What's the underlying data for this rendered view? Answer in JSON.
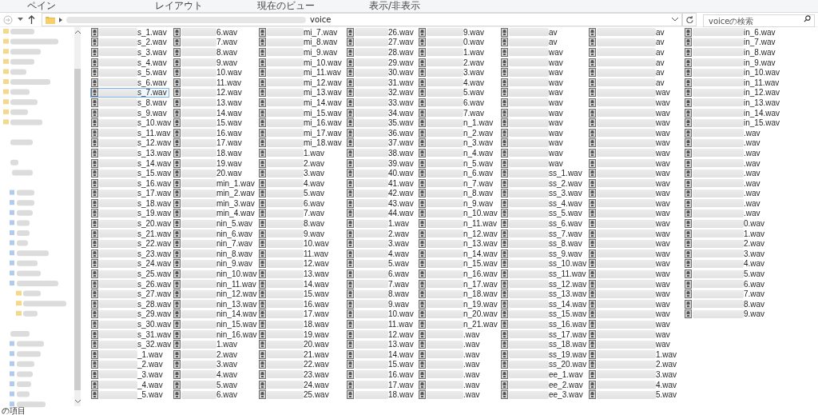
{
  "ribbon": {
    "groups": [
      "ペイン",
      "レイアウト",
      "現在のビュー",
      "表示/非表示"
    ]
  },
  "address_bar": {
    "current_folder": "voice"
  },
  "search": {
    "placeholder": "voiceの検索"
  },
  "columns": [
    {
      "files": [
        {
          "name": "s_1.wav",
          "selected": false
        },
        {
          "name": "s_2.wav",
          "selected": false
        },
        {
          "name": "s_3.wav",
          "selected": false
        },
        {
          "name": "s_4.wav",
          "selected": false
        },
        {
          "name": "s_5.wav",
          "selected": false
        },
        {
          "name": "s_6.wav",
          "selected": false
        },
        {
          "name": "s_7.wav",
          "selected": true
        },
        {
          "name": "s_8.wav",
          "selected": false
        },
        {
          "name": "s_9.wav",
          "selected": false
        },
        {
          "name": "s_10.wav",
          "selected": false
        },
        {
          "name": "s_11.wav",
          "selected": false
        },
        {
          "name": "s_12.wav",
          "selected": false
        },
        {
          "name": "s_13.wav",
          "selected": false
        },
        {
          "name": "s_14.wav",
          "selected": false
        },
        {
          "name": "s_15.wav",
          "selected": false
        },
        {
          "name": "s_16.wav",
          "selected": false
        },
        {
          "name": "s_17.wav",
          "selected": false
        },
        {
          "name": "s_18.wav",
          "selected": false
        },
        {
          "name": "s_19.wav",
          "selected": false
        },
        {
          "name": "s_20.wav",
          "selected": false
        },
        {
          "name": "s_21.wav",
          "selected": false
        },
        {
          "name": "s_22.wav",
          "selected": false
        },
        {
          "name": "s_23.wav",
          "selected": false
        },
        {
          "name": "s_24.wav",
          "selected": false
        },
        {
          "name": "s_25.wav",
          "selected": false
        },
        {
          "name": "s_26.wav",
          "selected": false
        },
        {
          "name": "s_27.wav",
          "selected": false
        },
        {
          "name": "s_28.wav",
          "selected": false
        },
        {
          "name": "s_29.wav",
          "selected": false
        },
        {
          "name": "s_30.wav",
          "selected": false
        },
        {
          "name": "s_31.wav",
          "selected": false
        },
        {
          "name": "s_32.wav",
          "selected": false
        },
        {
          "name": "_1.wav",
          "selected": false
        },
        {
          "name": "_2.wav",
          "selected": false
        },
        {
          "name": "_3.wav",
          "selected": false
        },
        {
          "name": "_4.wav",
          "selected": false
        },
        {
          "name": "_5.wav",
          "selected": false
        }
      ]
    },
    {
      "files": [
        {
          "name": "6.wav",
          "selected": false
        },
        {
          "name": "7.wav",
          "selected": false
        },
        {
          "name": "8.wav",
          "selected": false
        },
        {
          "name": "9.wav",
          "selected": false
        },
        {
          "name": "10.wav",
          "selected": false
        },
        {
          "name": "11.wav",
          "selected": false
        },
        {
          "name": "12.wav",
          "selected": false
        },
        {
          "name": "13.wav",
          "selected": false
        },
        {
          "name": "14.wav",
          "selected": false
        },
        {
          "name": "15.wav",
          "selected": false
        },
        {
          "name": "16.wav",
          "selected": false
        },
        {
          "name": "17.wav",
          "selected": false
        },
        {
          "name": "18.wav",
          "selected": false
        },
        {
          "name": "19.wav",
          "selected": false
        },
        {
          "name": "20.wav",
          "selected": false
        },
        {
          "name": "min_1.wav",
          "selected": false
        },
        {
          "name": "min_2.wav",
          "selected": false
        },
        {
          "name": "min_3.wav",
          "selected": false
        },
        {
          "name": "min_4.wav",
          "selected": false
        },
        {
          "name": "nin_5.wav",
          "selected": false
        },
        {
          "name": "nin_6.wav",
          "selected": false
        },
        {
          "name": "nin_7.wav",
          "selected": false
        },
        {
          "name": "nin_8.wav",
          "selected": false
        },
        {
          "name": "nin_9.wav",
          "selected": false
        },
        {
          "name": "nin_10.wav",
          "selected": false
        },
        {
          "name": "nin_11.wav",
          "selected": false
        },
        {
          "name": "nin_12.wav",
          "selected": false
        },
        {
          "name": "nin_13.wav",
          "selected": false
        },
        {
          "name": "nin_14.wav",
          "selected": false
        },
        {
          "name": "nin_15.wav",
          "selected": false
        },
        {
          "name": "nin_16.wav",
          "selected": false
        },
        {
          "name": "1.wav",
          "selected": false
        },
        {
          "name": "2.wav",
          "selected": false
        },
        {
          "name": "3.wav",
          "selected": false
        },
        {
          "name": "4.wav",
          "selected": false
        },
        {
          "name": "5.wav",
          "selected": false
        },
        {
          "name": "6.wav",
          "selected": false
        }
      ]
    },
    {
      "files": [
        {
          "name": "mi_7.wav",
          "selected": false
        },
        {
          "name": "mi_8.wav",
          "selected": false
        },
        {
          "name": "mi_9.wav",
          "selected": false
        },
        {
          "name": "mi_10.wav",
          "selected": false
        },
        {
          "name": "mi_11.wav",
          "selected": false
        },
        {
          "name": "mi_12.wav",
          "selected": false
        },
        {
          "name": "mi_13.wav",
          "selected": false
        },
        {
          "name": "mi_14.wav",
          "selected": false
        },
        {
          "name": "mi_15.wav",
          "selected": false
        },
        {
          "name": "mi_16.wav",
          "selected": false
        },
        {
          "name": "mi_17.wav",
          "selected": false
        },
        {
          "name": "mi_18.wav",
          "selected": false
        },
        {
          "name": "1.wav",
          "selected": false
        },
        {
          "name": "2.wav",
          "selected": false
        },
        {
          "name": "3.wav",
          "selected": false
        },
        {
          "name": "4.wav",
          "selected": false
        },
        {
          "name": "5.wav",
          "selected": false
        },
        {
          "name": "6.wav",
          "selected": false
        },
        {
          "name": "7.wav",
          "selected": false
        },
        {
          "name": "8.wav",
          "selected": false
        },
        {
          "name": "9.wav",
          "selected": false
        },
        {
          "name": "10.wav",
          "selected": false
        },
        {
          "name": "11.wav",
          "selected": false
        },
        {
          "name": "12.wav",
          "selected": false
        },
        {
          "name": "13.wav",
          "selected": false
        },
        {
          "name": "14.wav",
          "selected": false
        },
        {
          "name": "15.wav",
          "selected": false
        },
        {
          "name": "16.wav",
          "selected": false
        },
        {
          "name": "17.wav",
          "selected": false
        },
        {
          "name": "18.wav",
          "selected": false
        },
        {
          "name": "19.wav",
          "selected": false
        },
        {
          "name": "20.wav",
          "selected": false
        },
        {
          "name": "21.wav",
          "selected": false
        },
        {
          "name": "22.wav",
          "selected": false
        },
        {
          "name": "23.wav",
          "selected": false
        },
        {
          "name": "24.wav",
          "selected": false
        },
        {
          "name": "25.wav",
          "selected": false
        }
      ]
    },
    {
      "files": [
        {
          "name": "26.wav",
          "selected": false
        },
        {
          "name": "27.wav",
          "selected": false
        },
        {
          "name": "28.wav",
          "selected": false
        },
        {
          "name": "29.wav",
          "selected": false
        },
        {
          "name": "30.wav",
          "selected": false
        },
        {
          "name": "31.wav",
          "selected": false
        },
        {
          "name": "32.wav",
          "selected": false
        },
        {
          "name": "33.wav",
          "selected": false
        },
        {
          "name": "34.wav",
          "selected": false
        },
        {
          "name": "35.wav",
          "selected": false
        },
        {
          "name": "36.wav",
          "selected": false
        },
        {
          "name": "37.wav",
          "selected": false
        },
        {
          "name": "38.wav",
          "selected": false
        },
        {
          "name": "39.wav",
          "selected": false
        },
        {
          "name": "40.wav",
          "selected": false
        },
        {
          "name": "41.wav",
          "selected": false
        },
        {
          "name": "42.wav",
          "selected": false
        },
        {
          "name": "43.wav",
          "selected": false
        },
        {
          "name": "44.wav",
          "selected": false
        },
        {
          "name": "1.wav",
          "selected": false
        },
        {
          "name": "2.wav",
          "selected": false
        },
        {
          "name": "3.wav",
          "selected": false
        },
        {
          "name": "4.wav",
          "selected": false
        },
        {
          "name": "5.wav",
          "selected": false
        },
        {
          "name": "6.wav",
          "selected": false
        },
        {
          "name": "7.wav",
          "selected": false
        },
        {
          "name": "8.wav",
          "selected": false
        },
        {
          "name": "9.wav",
          "selected": false
        },
        {
          "name": "10.wav",
          "selected": false
        },
        {
          "name": "11.wav",
          "selected": false
        },
        {
          "name": "12.wav",
          "selected": false
        },
        {
          "name": "13.wav",
          "selected": false
        },
        {
          "name": "14.wav",
          "selected": false
        },
        {
          "name": "15.wav",
          "selected": false
        },
        {
          "name": "16.wav",
          "selected": false
        },
        {
          "name": "17.wav",
          "selected": false
        },
        {
          "name": "18.wav",
          "selected": false
        }
      ]
    },
    {
      "files": [
        {
          "name": "9.wav",
          "selected": false
        },
        {
          "name": "0.wav",
          "selected": false
        },
        {
          "name": "1.wav",
          "selected": false
        },
        {
          "name": "2.wav",
          "selected": false
        },
        {
          "name": "3.wav",
          "selected": false
        },
        {
          "name": "4.wav",
          "selected": false
        },
        {
          "name": "5.wav",
          "selected": false
        },
        {
          "name": "6.wav",
          "selected": false
        },
        {
          "name": "7.wav",
          "selected": false
        },
        {
          "name": "n_1.wav",
          "selected": false
        },
        {
          "name": "n_2.wav",
          "selected": false
        },
        {
          "name": "n_3.wav",
          "selected": false
        },
        {
          "name": "n_4.wav",
          "selected": false
        },
        {
          "name": "n_5.wav",
          "selected": false
        },
        {
          "name": "n_6.wav",
          "selected": false
        },
        {
          "name": "n_7.wav",
          "selected": false
        },
        {
          "name": "n_8.wav",
          "selected": false
        },
        {
          "name": "n_9.wav",
          "selected": false
        },
        {
          "name": "n_10.wav",
          "selected": false
        },
        {
          "name": "n_11.wav",
          "selected": false
        },
        {
          "name": "n_12.wav",
          "selected": false
        },
        {
          "name": "n_13.wav",
          "selected": false
        },
        {
          "name": "n_14.wav",
          "selected": false
        },
        {
          "name": "n_15.wav",
          "selected": false
        },
        {
          "name": "n_16.wav",
          "selected": false
        },
        {
          "name": "n_17.wav",
          "selected": false
        },
        {
          "name": "n_18.wav",
          "selected": false
        },
        {
          "name": "n_19.wav",
          "selected": false
        },
        {
          "name": "n_20.wav",
          "selected": false
        },
        {
          "name": "n_21.wav",
          "selected": false
        },
        {
          "name": ".wav",
          "selected": false
        },
        {
          "name": ".wav",
          "selected": false
        },
        {
          "name": ".wav",
          "selected": false
        },
        {
          "name": ".wav",
          "selected": false
        },
        {
          "name": ".wav",
          "selected": false
        },
        {
          "name": ".wav",
          "selected": false
        },
        {
          "name": ".wav",
          "selected": false
        }
      ]
    },
    {
      "files": [
        {
          "name": "av",
          "selected": false
        },
        {
          "name": "av",
          "selected": false
        },
        {
          "name": "wav",
          "selected": false
        },
        {
          "name": "wav",
          "selected": false
        },
        {
          "name": "wav",
          "selected": false
        },
        {
          "name": "wav",
          "selected": false
        },
        {
          "name": "wav",
          "selected": false
        },
        {
          "name": "wav",
          "selected": false
        },
        {
          "name": "wav",
          "selected": false
        },
        {
          "name": "wav",
          "selected": false
        },
        {
          "name": "wav",
          "selected": false
        },
        {
          "name": "wav",
          "selected": false
        },
        {
          "name": "wav",
          "selected": false
        },
        {
          "name": "wav",
          "selected": false
        },
        {
          "name": "ss_1.wav",
          "selected": false
        },
        {
          "name": "ss_2.wav",
          "selected": false
        },
        {
          "name": "ss_3.wav",
          "selected": false
        },
        {
          "name": "ss_4.wav",
          "selected": false
        },
        {
          "name": "ss_5.wav",
          "selected": false
        },
        {
          "name": "ss_6.wav",
          "selected": false
        },
        {
          "name": "ss_7.wav",
          "selected": false
        },
        {
          "name": "ss_8.wav",
          "selected": false
        },
        {
          "name": "ss_9.wav",
          "selected": false
        },
        {
          "name": "ss_10.wav",
          "selected": false
        },
        {
          "name": "ss_11.wav",
          "selected": false
        },
        {
          "name": "ss_12.wav",
          "selected": false
        },
        {
          "name": "ss_13.wav",
          "selected": false
        },
        {
          "name": "ss_14.wav",
          "selected": false
        },
        {
          "name": "ss_15.wav",
          "selected": false
        },
        {
          "name": "ss_16.wav",
          "selected": false
        },
        {
          "name": "ss_17.wav",
          "selected": false
        },
        {
          "name": "ss_18.wav",
          "selected": false
        },
        {
          "name": "ss_19.wav",
          "selected": false
        },
        {
          "name": "ss_20.wav",
          "selected": false
        },
        {
          "name": "ee_1.wav",
          "selected": false
        },
        {
          "name": "ee_2.wav",
          "selected": false
        },
        {
          "name": "ee_3.wav",
          "selected": false
        }
      ]
    },
    {
      "files": [
        {
          "name": "av",
          "selected": false
        },
        {
          "name": "av",
          "selected": false
        },
        {
          "name": "av",
          "selected": false
        },
        {
          "name": "av",
          "selected": false
        },
        {
          "name": "av",
          "selected": false
        },
        {
          "name": "av",
          "selected": false
        },
        {
          "name": "wav",
          "selected": false
        },
        {
          "name": "wav",
          "selected": false
        },
        {
          "name": "wav",
          "selected": false
        },
        {
          "name": "wav",
          "selected": false
        },
        {
          "name": "wav",
          "selected": false
        },
        {
          "name": "wav",
          "selected": false
        },
        {
          "name": "wav",
          "selected": false
        },
        {
          "name": "wav",
          "selected": false
        },
        {
          "name": "wav",
          "selected": false
        },
        {
          "name": "wav",
          "selected": false
        },
        {
          "name": "wav",
          "selected": false
        },
        {
          "name": "wav",
          "selected": false
        },
        {
          "name": "wav",
          "selected": false
        },
        {
          "name": "wav",
          "selected": false
        },
        {
          "name": "wav",
          "selected": false
        },
        {
          "name": "wav",
          "selected": false
        },
        {
          "name": "wav",
          "selected": false
        },
        {
          "name": "wav",
          "selected": false
        },
        {
          "name": "wav",
          "selected": false
        },
        {
          "name": "wav",
          "selected": false
        },
        {
          "name": "wav",
          "selected": false
        },
        {
          "name": "wav",
          "selected": false
        },
        {
          "name": "wav",
          "selected": false
        },
        {
          "name": "wav",
          "selected": false
        },
        {
          "name": "wav",
          "selected": false
        },
        {
          "name": "wav",
          "selected": false
        },
        {
          "name": "1.wav",
          "selected": false
        },
        {
          "name": "2.wav",
          "selected": false
        },
        {
          "name": "3.wav",
          "selected": false
        },
        {
          "name": "4.wav",
          "selected": false
        },
        {
          "name": "5.wav",
          "selected": false
        }
      ]
    },
    {
      "files": [
        {
          "name": "in_6.wav",
          "selected": false
        },
        {
          "name": "in_7.wav",
          "selected": false
        },
        {
          "name": "in_8.wav",
          "selected": false
        },
        {
          "name": "in_9.wav",
          "selected": false
        },
        {
          "name": "in_10.wav",
          "selected": false
        },
        {
          "name": "in_11.wav",
          "selected": false
        },
        {
          "name": "in_12.wav",
          "selected": false
        },
        {
          "name": "in_13.wav",
          "selected": false
        },
        {
          "name": "in_14.wav",
          "selected": false
        },
        {
          "name": "in_15.wav",
          "selected": false
        },
        {
          "name": ".wav",
          "selected": false
        },
        {
          "name": ".wav",
          "selected": false
        },
        {
          "name": ".wav",
          "selected": false
        },
        {
          "name": ".wav",
          "selected": false
        },
        {
          "name": ".wav",
          "selected": false
        },
        {
          "name": ".wav",
          "selected": false
        },
        {
          "name": ".wav",
          "selected": false
        },
        {
          "name": ".wav",
          "selected": false
        },
        {
          "name": ".wav",
          "selected": false
        },
        {
          "name": "0.wav",
          "selected": false
        },
        {
          "name": "1.wav",
          "selected": false
        },
        {
          "name": "2.wav",
          "selected": false
        },
        {
          "name": "3.wav",
          "selected": false
        },
        {
          "name": "4.wav",
          "selected": false
        },
        {
          "name": "5.wav",
          "selected": false
        },
        {
          "name": "6.wav",
          "selected": false
        },
        {
          "name": "7.wav",
          "selected": false
        },
        {
          "name": "8.wav",
          "selected": false
        },
        {
          "name": "9.wav",
          "selected": false
        }
      ]
    }
  ],
  "status_bar": {
    "item_count": "の項目"
  }
}
